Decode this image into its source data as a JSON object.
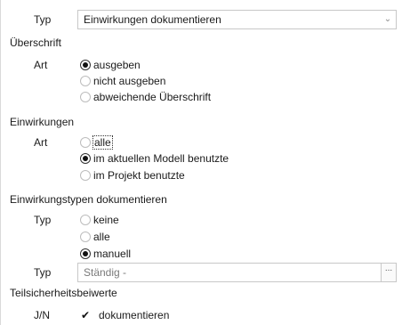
{
  "typ_row": {
    "label": "Typ",
    "dropdown_value": "Einwirkungen dokumentieren",
    "dropdown_arrow": "⌄"
  },
  "ueberschrift": {
    "title": "Überschrift",
    "art_label": "Art",
    "options": [
      "ausgeben",
      "nicht ausgeben",
      "abweichende Überschrift"
    ],
    "selected_index": 0
  },
  "einwirkungen": {
    "title": "Einwirkungen",
    "art_label": "Art",
    "options": [
      "alle",
      "im aktuellen Modell benutzte",
      "im Projekt benutzte"
    ],
    "selected_index": 1,
    "focused_index": 0
  },
  "einwirkungstypen": {
    "title": "Einwirkungstypen dokumentieren",
    "typ_label": "Typ",
    "options": [
      "keine",
      "alle",
      "manuell"
    ],
    "selected_index": 2,
    "typ2_label": "Typ",
    "typ2_value": "Ständig -",
    "typ2_button": "..."
  },
  "teilsicherheitsbeiwerte": {
    "title": "Teilsicherheitsbeiwerte",
    "jn_label": "J/N",
    "checkbox_mark": "✔",
    "checkbox_label": "dokumentieren",
    "checked": true
  }
}
